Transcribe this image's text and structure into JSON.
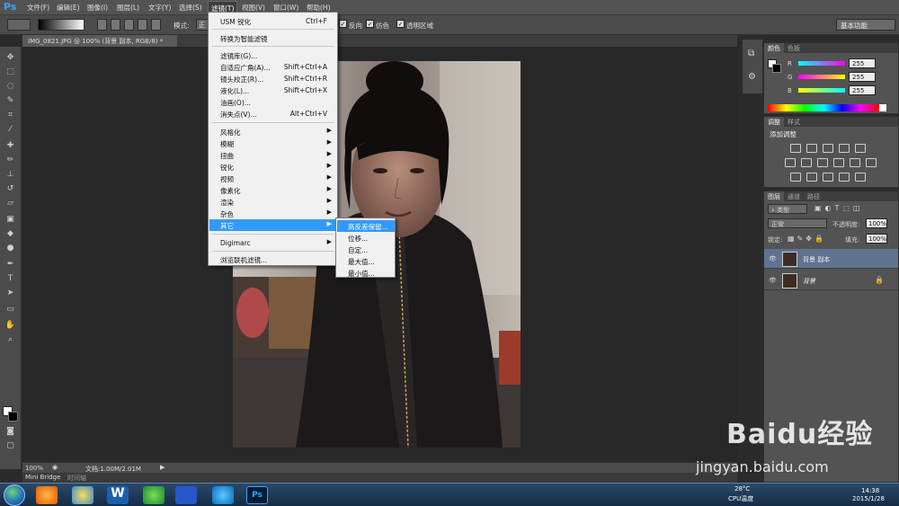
{
  "menubar": {
    "logo": "Ps",
    "items": [
      "文件(F)",
      "编辑(E)",
      "图像(I)",
      "图层(L)",
      "文字(Y)",
      "选择(S)",
      "滤镜(T)",
      "视图(V)",
      "窗口(W)",
      "帮助(H)"
    ]
  },
  "options": {
    "mode_label": "模式:",
    "mode_value": "正",
    "reverse": "反向",
    "dither": "仿色",
    "transparency": "透明区域",
    "workspace": "基本功能"
  },
  "document": {
    "tab_title": "IMG_0821.JPG @ 100% (背景 副本, RGB/8) *",
    "zoom": "100%",
    "doc_info": "文档:1.00M/2.01M"
  },
  "minibridge": {
    "tab1": "Mini Bridge",
    "tab2": "时间轴"
  },
  "filter_menu": {
    "items": [
      {
        "label": "USM 锐化",
        "shortcut": "Ctrl+F"
      },
      {
        "label": "转换为智能滤镜",
        "shortcut": ""
      },
      {
        "label": "滤镜库(G)...",
        "shortcut": ""
      },
      {
        "label": "自适应广角(A)...",
        "shortcut": "Shift+Ctrl+A"
      },
      {
        "label": "镜头校正(R)...",
        "shortcut": "Shift+Ctrl+R"
      },
      {
        "label": "液化(L)...",
        "shortcut": "Shift+Ctrl+X"
      },
      {
        "label": "油画(O)...",
        "shortcut": ""
      },
      {
        "label": "消失点(V)...",
        "shortcut": "Alt+Ctrl+V"
      },
      {
        "label": "风格化",
        "shortcut": ""
      },
      {
        "label": "模糊",
        "shortcut": ""
      },
      {
        "label": "扭曲",
        "shortcut": ""
      },
      {
        "label": "锐化",
        "shortcut": ""
      },
      {
        "label": "视频",
        "shortcut": ""
      },
      {
        "label": "像素化",
        "shortcut": ""
      },
      {
        "label": "渲染",
        "shortcut": ""
      },
      {
        "label": "杂色",
        "shortcut": ""
      },
      {
        "label": "其它",
        "shortcut": ""
      },
      {
        "label": "Digimarc",
        "shortcut": ""
      },
      {
        "label": "浏览联机滤镜...",
        "shortcut": ""
      }
    ]
  },
  "submenu": {
    "items": [
      "高反差保留...",
      "位移...",
      "自定...",
      "最大值...",
      "最小值..."
    ]
  },
  "color_panel": {
    "tab1": "颜色",
    "tab2": "色板",
    "channels": [
      {
        "label": "R",
        "value": "255",
        "color": "#ff00ff"
      },
      {
        "label": "G",
        "value": "255",
        "color": "#ffff00"
      },
      {
        "label": "B",
        "value": "255",
        "color": "#00ffff"
      }
    ]
  },
  "adjust_panel": {
    "tab1": "调整",
    "tab2": "样式",
    "title": "添加调整"
  },
  "layers_panel": {
    "tab1": "图层",
    "tab2": "通道",
    "tab3": "路径",
    "kind": "类型",
    "blend_mode": "正常",
    "opacity_label": "不透明度:",
    "opacity": "100%",
    "lock_label": "锁定:",
    "fill_label": "填充:",
    "fill": "100%",
    "layers": [
      {
        "name": "背景 副本",
        "selected": true
      },
      {
        "name": "背景",
        "selected": false
      }
    ]
  },
  "taskbar": {
    "temperature": "28°C",
    "cpu": "CPU温度",
    "time": "14:38",
    "date": "2015/1/28"
  },
  "watermark": {
    "brand": "Baidu经验",
    "url": "jingyan.baidu.com"
  }
}
